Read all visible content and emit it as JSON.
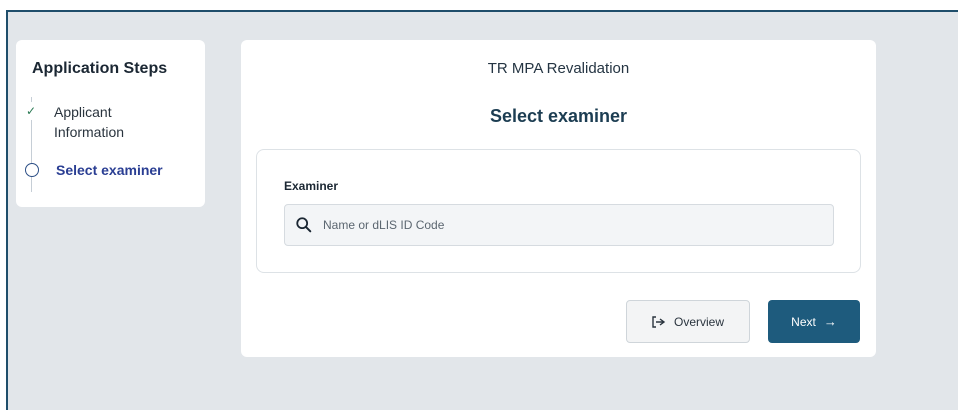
{
  "sidebar": {
    "title": "Application Steps",
    "steps": [
      {
        "label": "Applicant Information",
        "status": "completed",
        "icon": "check-icon"
      },
      {
        "label": "Select examiner",
        "status": "current",
        "icon": "circle-icon"
      }
    ]
  },
  "main": {
    "subtitle": "TR MPA Revalidation",
    "heading": "Select examiner",
    "examiner_field": {
      "label": "Examiner",
      "placeholder": "Name or dLIS ID Code",
      "value": ""
    },
    "buttons": {
      "overview_label": "Overview",
      "next_label": "Next"
    }
  },
  "colors": {
    "primary": "#1e5b7d",
    "background": "#e2e6ea",
    "active_step": "#2a3e93",
    "completed_check": "#2b7a54"
  }
}
